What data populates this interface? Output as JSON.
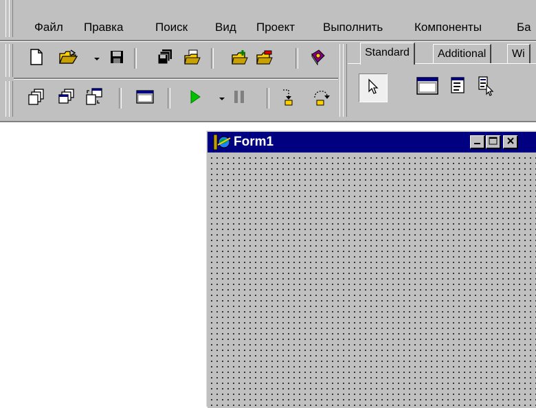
{
  "menu": {
    "items": [
      "Файл",
      "Правка",
      "Поиск",
      "Вид",
      "Проект",
      "Выполнить",
      "Компоненты",
      "Ба"
    ]
  },
  "palette": {
    "tabs": [
      "Standard",
      "Additional",
      "Wi"
    ],
    "active_tab": "Standard"
  },
  "form": {
    "title": "Form1"
  },
  "colors": {
    "face": "#c0c0c0",
    "titlebar": "#000080",
    "shadow": "#808080",
    "highlight": "#ffffff"
  },
  "icons": {
    "toolbar_row1": [
      "new-file-icon",
      "open-folder-icon",
      "save-icon",
      "save-all-icon",
      "open-project-icon",
      "add-to-project-icon",
      "remove-from-project-icon",
      "help-book-icon"
    ],
    "toolbar_row2": [
      "view-unit-icon",
      "view-form-icon",
      "toggle-form-unit-icon",
      "new-form-icon",
      "run-icon",
      "pause-icon",
      "trace-into-icon",
      "step-over-icon"
    ],
    "components": [
      "pointer-icon",
      "frames-icon",
      "mainmenu-icon",
      "popupmenu-icon"
    ]
  }
}
